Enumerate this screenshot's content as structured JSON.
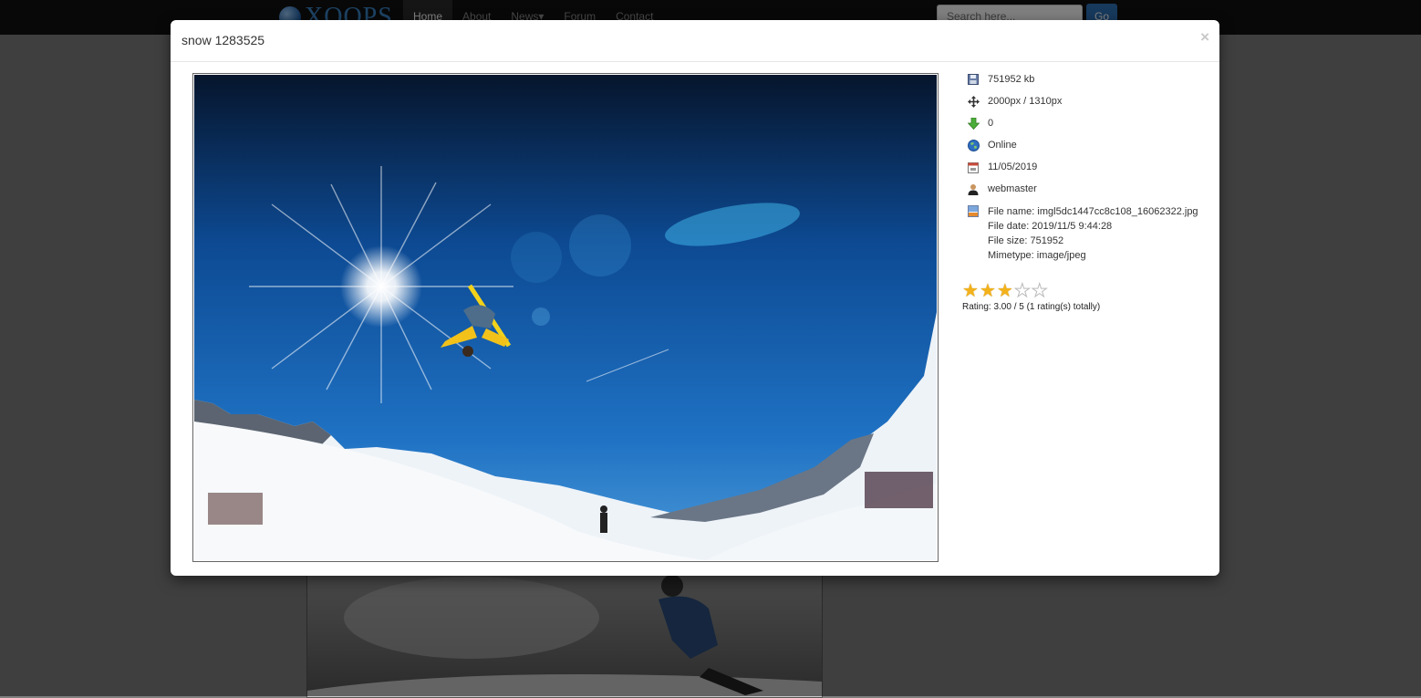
{
  "navbar": {
    "logo_text": "XOOPS",
    "items": [
      {
        "label": "Home",
        "active": true
      },
      {
        "label": "About"
      },
      {
        "label": "News▾"
      },
      {
        "label": "Forum"
      },
      {
        "label": "Contact"
      }
    ],
    "search": {
      "placeholder": "Search here...",
      "button_label": "Go"
    }
  },
  "modal": {
    "title": "snow 1283525",
    "close_label": "×",
    "info": {
      "filesize": "751952 kb",
      "dimensions": "2000px / 1310px",
      "downloads": "0",
      "status": "Online",
      "date": "11/05/2019",
      "author": "webmaster",
      "exif": {
        "file_name": "File name: imgl5dc1447cc8c108_16062322.jpg",
        "file_date": "File date: 2019/11/5 9:44:28",
        "file_size": "File size: 751952",
        "mimetype": "Mimetype: image/jpeg"
      }
    },
    "rating": {
      "value": 3,
      "max": 5,
      "text": "Rating: 3.00 / 5 (1 rating(s) totally)"
    }
  },
  "colors": {
    "accent": "#2f73b8",
    "star": "#f3b21b",
    "sky": "#1f6fc0"
  }
}
